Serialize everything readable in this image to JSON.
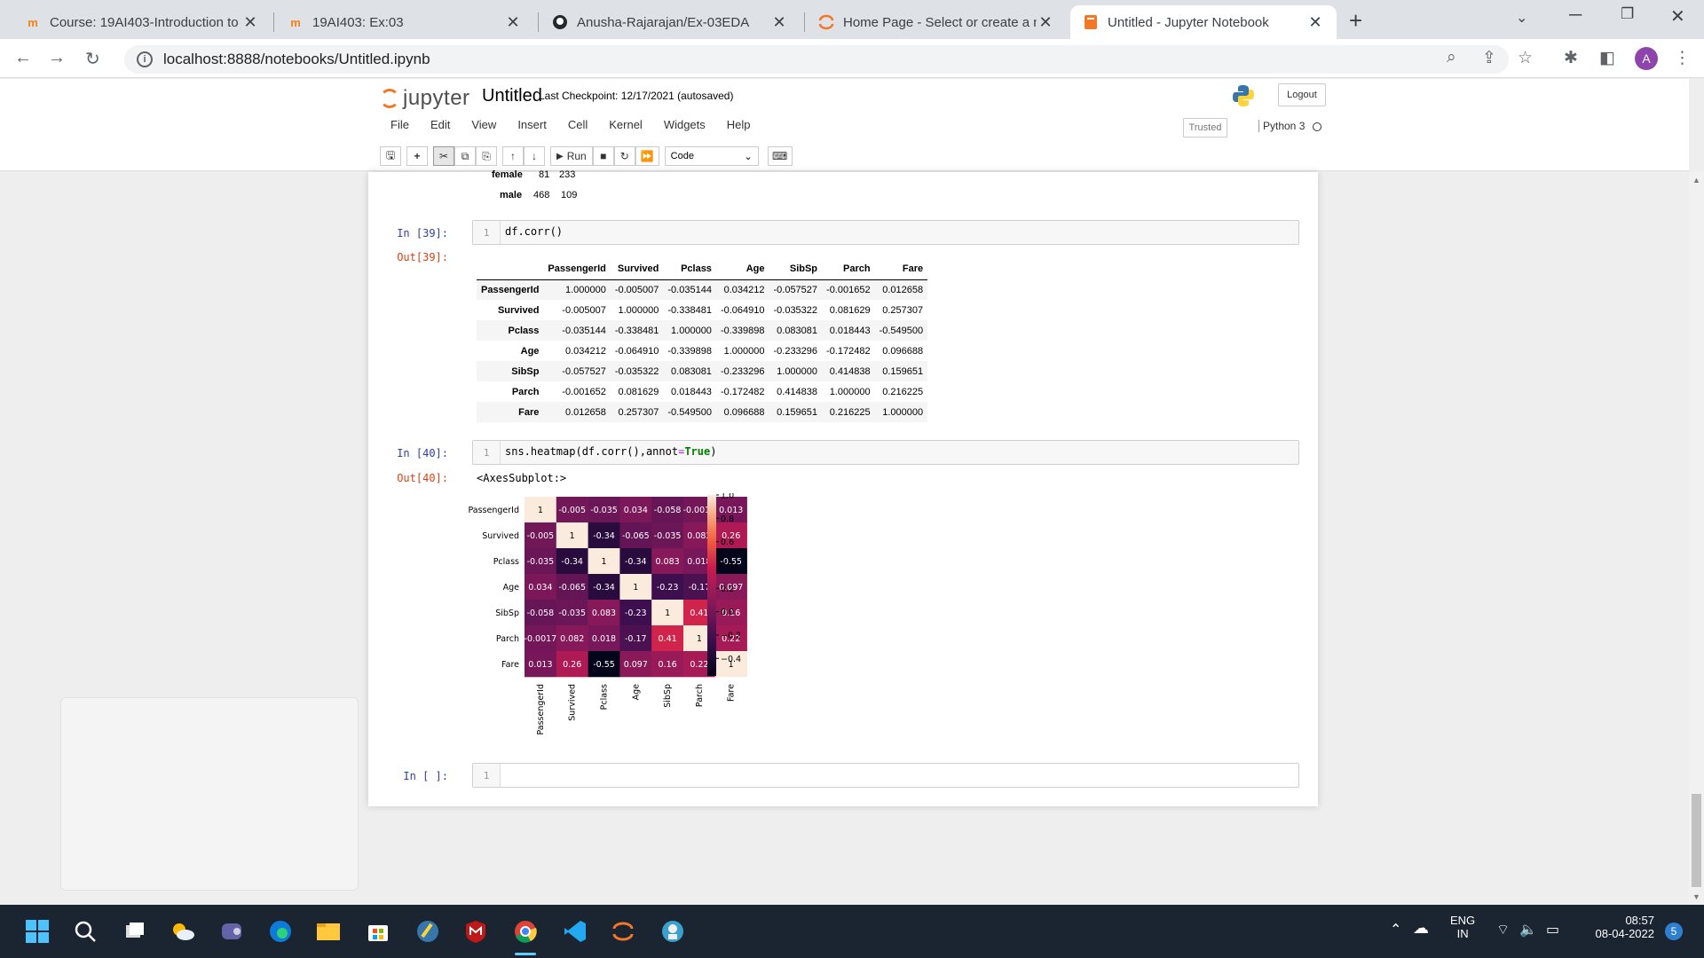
{
  "browser": {
    "tabs": [
      {
        "title": "Course: 19AI403-Introduction to",
        "icon": "moodle-icon"
      },
      {
        "title": "19AI403: Ex:03",
        "icon": "moodle-icon"
      },
      {
        "title": "Anusha-Rajarajan/Ex-03EDA",
        "icon": "github-icon"
      },
      {
        "title": "Home Page - Select or create a n",
        "icon": "jupyter-icon"
      },
      {
        "title": "Untitled - Jupyter Notebook",
        "icon": "notebook-icon"
      }
    ],
    "url": "localhost:8888/notebooks/Untitled.ipynb",
    "profile_initial": "A"
  },
  "jupyter": {
    "logo_text": "jupyter",
    "notebook_name": "Untitled",
    "checkpoint": "Last Checkpoint: 12/17/2021  (autosaved)",
    "logout_label": "Logout",
    "menu": [
      "File",
      "Edit",
      "View",
      "Insert",
      "Cell",
      "Kernel",
      "Widgets",
      "Help"
    ],
    "trusted_label": "Trusted",
    "kernel_name": "Python 3",
    "run_label": "Run",
    "cell_type": "Code"
  },
  "cells": {
    "prev_output": {
      "rows": [
        {
          "label": "female",
          "a": "81",
          "b": "233"
        },
        {
          "label": "male",
          "a": "468",
          "b": "109"
        }
      ]
    },
    "c39": {
      "in_prompt": "In [39]:",
      "out_prompt": "Out[39]:",
      "line": "1",
      "code": "df.corr()"
    },
    "c40": {
      "in_prompt": "In [40]:",
      "out_prompt": "Out[40]:",
      "line": "1",
      "code_a": "sns.heatmap(df.corr(),annot",
      "code_op": "=",
      "code_kw": "True",
      "code_b": ")",
      "output_text": "<AxesSubplot:>"
    },
    "empty": {
      "in_prompt": "In [ ]:",
      "line": "1"
    }
  },
  "corr_table": {
    "columns": [
      "PassengerId",
      "Survived",
      "Pclass",
      "Age",
      "SibSp",
      "Parch",
      "Fare"
    ],
    "rows": [
      {
        "label": "PassengerId",
        "values": [
          "1.000000",
          "-0.005007",
          "-0.035144",
          "0.034212",
          "-0.057527",
          "-0.001652",
          "0.012658"
        ]
      },
      {
        "label": "Survived",
        "values": [
          "-0.005007",
          "1.000000",
          "-0.338481",
          "-0.064910",
          "-0.035322",
          "0.081629",
          "0.257307"
        ]
      },
      {
        "label": "Pclass",
        "values": [
          "-0.035144",
          "-0.338481",
          "1.000000",
          "-0.339898",
          "0.083081",
          "0.018443",
          "-0.549500"
        ]
      },
      {
        "label": "Age",
        "values": [
          "0.034212",
          "-0.064910",
          "-0.339898",
          "1.000000",
          "-0.233296",
          "-0.172482",
          "0.096688"
        ]
      },
      {
        "label": "SibSp",
        "values": [
          "-0.057527",
          "-0.035322",
          "0.083081",
          "-0.233296",
          "1.000000",
          "0.414838",
          "0.159651"
        ]
      },
      {
        "label": "Parch",
        "values": [
          "-0.001652",
          "0.081629",
          "0.018443",
          "-0.172482",
          "0.414838",
          "1.000000",
          "0.216225"
        ]
      },
      {
        "label": "Fare",
        "values": [
          "0.012658",
          "0.257307",
          "-0.549500",
          "0.096688",
          "0.159651",
          "0.216225",
          "1.000000"
        ]
      }
    ]
  },
  "chart_data": {
    "type": "heatmap",
    "x_labels": [
      "PassengerId",
      "Survived",
      "Pclass",
      "Age",
      "SibSp",
      "Parch",
      "Fare"
    ],
    "y_labels": [
      "PassengerId",
      "Survived",
      "Pclass",
      "Age",
      "SibSp",
      "Parch",
      "Fare"
    ],
    "values": [
      [
        1,
        -0.005,
        -0.035,
        0.034,
        -0.058,
        -0.0017,
        0.013
      ],
      [
        -0.005,
        1,
        -0.34,
        -0.065,
        -0.035,
        0.082,
        0.26
      ],
      [
        -0.035,
        -0.34,
        1,
        -0.34,
        0.083,
        0.018,
        -0.55
      ],
      [
        0.034,
        -0.065,
        -0.34,
        1,
        -0.23,
        -0.17,
        0.097
      ],
      [
        -0.058,
        -0.035,
        0.083,
        -0.23,
        1,
        0.41,
        0.16
      ],
      [
        -0.0017,
        0.082,
        0.018,
        -0.17,
        0.41,
        1,
        0.22
      ],
      [
        0.013,
        0.26,
        -0.55,
        0.097,
        0.16,
        0.22,
        1
      ]
    ],
    "annotations": [
      [
        "1",
        "-0.005",
        "-0.035",
        "0.034",
        "-0.058",
        "-0.0017",
        "0.013"
      ],
      [
        "-0.005",
        "1",
        "-0.34",
        "-0.065",
        "-0.035",
        "0.082",
        "0.26"
      ],
      [
        "-0.035",
        "-0.34",
        "1",
        "-0.34",
        "0.083",
        "0.018",
        "-0.55"
      ],
      [
        "0.034",
        "-0.065",
        "-0.34",
        "1",
        "-0.23",
        "-0.17",
        "0.097"
      ],
      [
        "-0.058",
        "-0.035",
        "0.083",
        "-0.23",
        "1",
        "0.41",
        "0.16"
      ],
      [
        "-0.0017",
        "0.082",
        "0.018",
        "-0.17",
        "0.41",
        "1",
        "0.22"
      ],
      [
        "0.013",
        "0.26",
        "-0.55",
        "0.097",
        "0.16",
        "0.22",
        "1"
      ]
    ],
    "colorbar": {
      "range": [
        -0.55,
        1.0
      ],
      "ticks": [
        1.0,
        0.8,
        0.6,
        0.4,
        0.2,
        0.0,
        -0.2,
        -0.4
      ],
      "tick_labels": [
        "1.0",
        "0.8",
        "0.6",
        "0.4",
        "0.2",
        "0.0",
        "−0.2",
        "−0.4"
      ],
      "colormap": "rocket"
    }
  },
  "taskbar": {
    "lang_top": "ENG",
    "lang_bottom": "IN",
    "time": "08:57",
    "date": "08-04-2022",
    "notifications": "5",
    "apps": [
      "start-icon",
      "search-icon",
      "task-view-icon",
      "weather-icon",
      "teams-icon",
      "edge-icon",
      "file-explorer-icon",
      "store-icon",
      "python-idle-icon",
      "mcafee-icon",
      "chrome-icon",
      "vscode-icon",
      "jupyter-icon",
      "git-icon"
    ]
  }
}
